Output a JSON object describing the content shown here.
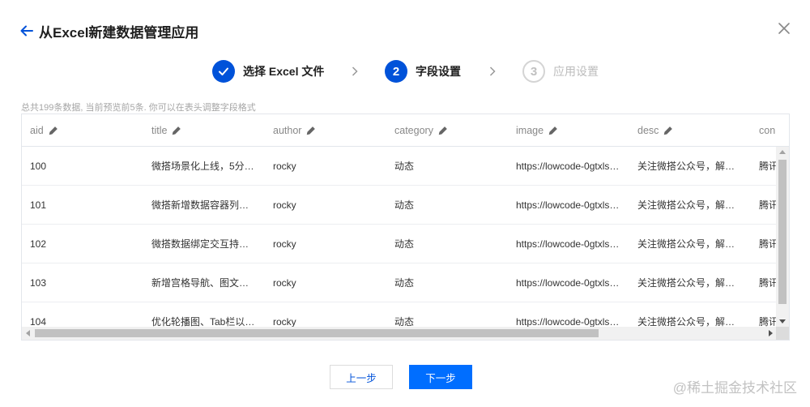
{
  "dialog": {
    "title": "从Excel新建数据管理应用"
  },
  "steps": [
    {
      "number": "1",
      "label": "选择 Excel 文件",
      "state": "done"
    },
    {
      "number": "2",
      "label": "字段设置",
      "state": "active"
    },
    {
      "number": "3",
      "label": "应用设置",
      "state": "pending"
    }
  ],
  "hint": "总共199条数据, 当前预览前5条. 你可以在表头调整字段格式",
  "table": {
    "columns": [
      "aid",
      "title",
      "author",
      "category",
      "image",
      "desc",
      "con"
    ],
    "rows": [
      [
        "100",
        "微搭场景化上线，5分…",
        "rocky",
        "动态",
        "https://lowcode-0gtxls…",
        "关注微搭公众号，解…",
        "腾讯"
      ],
      [
        "101",
        "微搭新增数据容器列…",
        "rocky",
        "动态",
        "https://lowcode-0gtxls…",
        "关注微搭公众号，解…",
        "腾讯"
      ],
      [
        "102",
        "微搭数据绑定交互持…",
        "rocky",
        "动态",
        "https://lowcode-0gtxls…",
        "关注微搭公众号，解…",
        "腾讯"
      ],
      [
        "103",
        "新增宫格导航、图文…",
        "rocky",
        "动态",
        "https://lowcode-0gtxls…",
        "关注微搭公众号，解…",
        "腾讯"
      ],
      [
        "104",
        "优化轮播图、Tab栏以…",
        "rocky",
        "动态",
        "https://lowcode-0gtxls…",
        "关注微搭公众号，解…",
        "腾讯"
      ]
    ]
  },
  "buttons": {
    "prev": "上一步",
    "next": "下一步"
  },
  "watermark": "@稀土掘金技术社区",
  "colors": {
    "primary": "#0052d9",
    "next_button": "#006eff",
    "hint_text": "#a6a6a6"
  },
  "icons": {
    "back": "arrow-left-icon",
    "close": "close-icon",
    "step_done": "check-icon",
    "step_separator": "chevron-right-icon",
    "column_edit": "pencil-icon"
  }
}
